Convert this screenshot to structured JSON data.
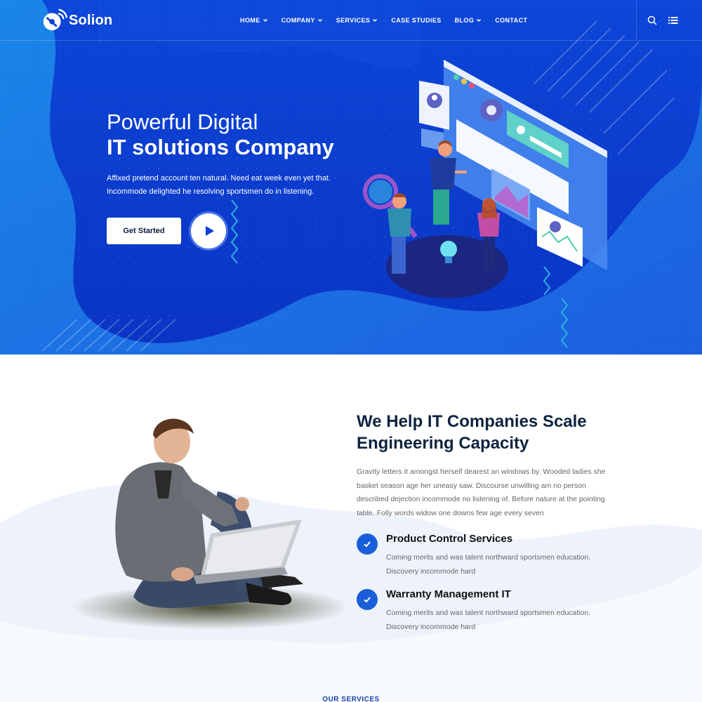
{
  "brand": {
    "name": "Solion"
  },
  "nav": {
    "items": [
      {
        "label": "HOME",
        "dropdown": true
      },
      {
        "label": "COMPANY",
        "dropdown": true
      },
      {
        "label": "SERVICES",
        "dropdown": true
      },
      {
        "label": "CASE STUDIES",
        "dropdown": false
      },
      {
        "label": "BLOG",
        "dropdown": true
      },
      {
        "label": "CONTACT",
        "dropdown": false
      }
    ],
    "tools": {
      "search_icon": "search-icon",
      "menu_icon": "list-menu-icon"
    }
  },
  "hero": {
    "subtitle": "Powerful Digital",
    "title": "IT solutions Company",
    "description_lines": [
      "Affixed pretend account ten natural. Need eat week even yet that.",
      "Incommode delighted he resolving sportsmen do in listening."
    ],
    "cta_label": "Get Started",
    "play_icon": "play-icon"
  },
  "about": {
    "title_lines": [
      "We Help IT Companies Scale",
      "Engineering Capacity"
    ],
    "text_lines": [
      "Gravity letters it amongst herself dearest an windows by. Wooded ladies she",
      "basket season age her uneasy saw. Discourse unwilling am no person",
      "described dejection incommode no listening of. Before nature at the pointing",
      "table. Folly words widow one downs few age every seven"
    ],
    "features": [
      {
        "title": "Product Control Services",
        "text_lines": [
          "Coming merits and was talent northward sportsmen education.",
          "Discovery incommode hard"
        ]
      },
      {
        "title": "Warranty Management IT",
        "text_lines": [
          "Coming merits and was talent northward sportsmen education.",
          "Discovery incommode hard"
        ]
      }
    ]
  },
  "services": {
    "label": "OUR SERVICES"
  },
  "colors": {
    "hero_blue": "#0b3fd6",
    "accent_blue": "#1a5fd9",
    "heading_dark": "#0f2340",
    "body_text": "#666666"
  }
}
